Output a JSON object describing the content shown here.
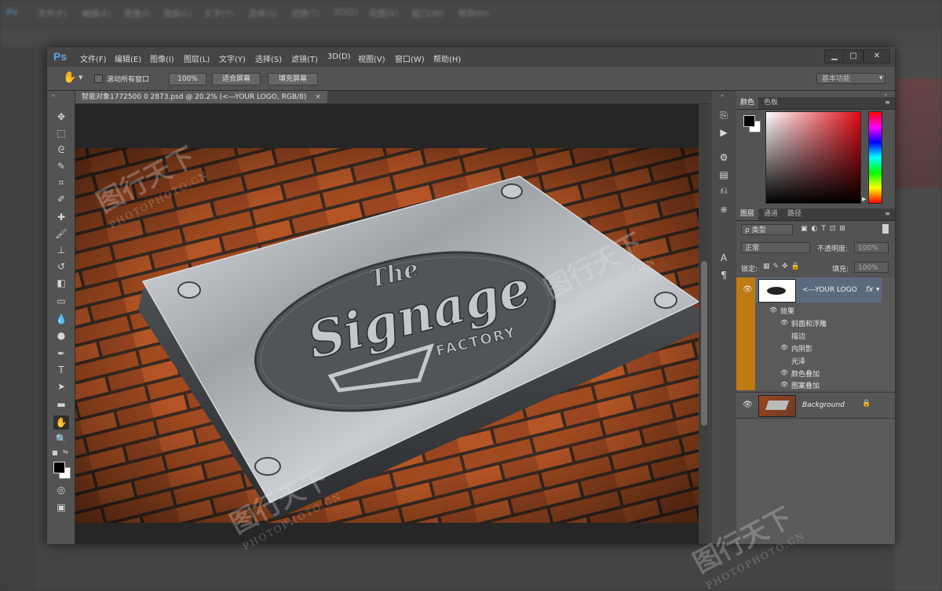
{
  "app": {
    "logo": "Ps",
    "bg_logo": "Ps"
  },
  "menu": [
    "文件(F)",
    "编辑(E)",
    "图像(I)",
    "图层(L)",
    "文字(Y)",
    "选择(S)",
    "滤镜(T)",
    "3D(D)",
    "视图(V)",
    "窗口(W)",
    "帮助(H)"
  ],
  "window_controls": {
    "minimize": "▁",
    "maximize": "□",
    "close": "✕"
  },
  "options": {
    "scroll_all": "滚动所有窗口",
    "zoom_100": "100%",
    "fit_screen": "适合屏幕",
    "fill_screen": "填充屏幕",
    "workspace": "基本功能"
  },
  "document": {
    "tab_title": "智能对象1772500 0 2873.psd @ 20.2% (<---YOUR LOGO, RGB/8)",
    "tab_close": "×",
    "sign_the": "The",
    "sign_main": "Signage",
    "sign_sub": "FACTORY"
  },
  "color_panel": {
    "tabs": [
      "颜色",
      "色板"
    ]
  },
  "layers_panel": {
    "tabs": [
      "图层",
      "通道",
      "路径"
    ],
    "filter_kind": "ρ 类型",
    "blend_mode": "正常",
    "opacity_label": "不透明度:",
    "opacity_value": "100%",
    "lock_label": "锁定:",
    "fill_label": "填充:",
    "fill_value": "100%",
    "layers": [
      {
        "name": "<---YOUR LOGO",
        "fx": "fx"
      },
      {
        "name": "Background",
        "lock": "🔒"
      }
    ],
    "effects_label": "效果",
    "effects": [
      "斜面和浮雕",
      "描边",
      "内阴影",
      "光泽",
      "颜色叠加",
      "图案叠加"
    ]
  },
  "watermark": {
    "cn": "图行天下",
    "en": "PHOTOPHOTO.CN"
  },
  "colors": {
    "accent_orange": "#c07a12",
    "selected_layer": "#5c6a7e",
    "ps_blue": "#5ba3e0"
  }
}
